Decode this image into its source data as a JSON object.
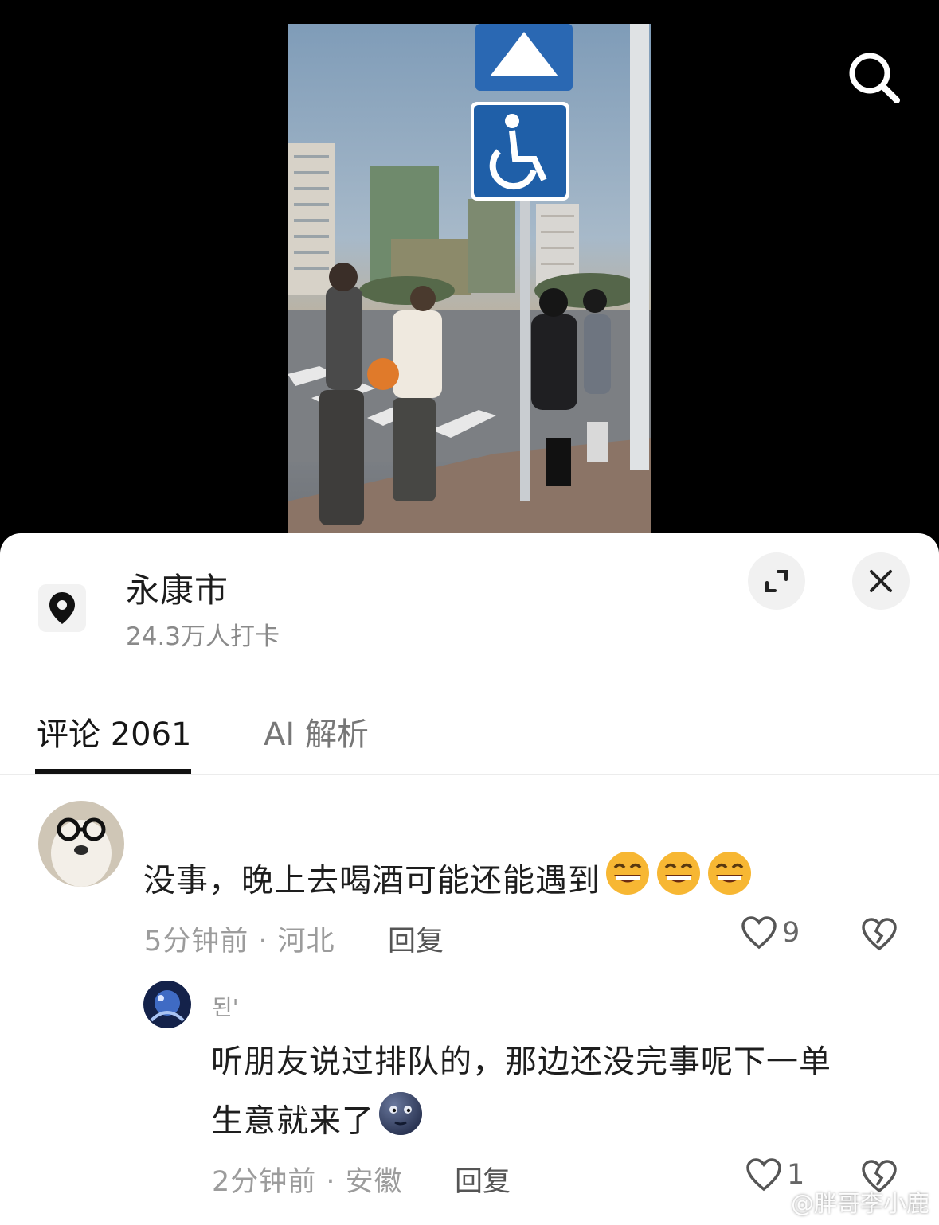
{
  "location": {
    "name": "永康市",
    "checkins": "24.3万人打卡"
  },
  "tabs": [
    {
      "label": "评论 2061",
      "active": true
    },
    {
      "label": "AI 解析",
      "active": false
    }
  ],
  "comments": [
    {
      "text": "没事，晚上去喝酒可能还能遇到",
      "emoji": [
        "grinning-face",
        "grinning-face",
        "grinning-face"
      ],
      "meta": "5分钟前 · 河北",
      "reply_label": "回复",
      "likes": "9",
      "replies": [
        {
          "author": "된'",
          "text_line1": "听朋友说过排队的，那边还没完事呢下一单",
          "text_line2": "生意就来了",
          "emoji": [
            "new-moon-face"
          ],
          "meta": "2分钟前 · 安徽",
          "reply_label": "回复",
          "likes": "1"
        }
      ]
    }
  ],
  "watermark": "@胖哥李小鹿",
  "colors": {
    "sheet_bg": "#ffffff",
    "video_bg": "#000000",
    "sign_blue": "#1f5fa8",
    "text_primary": "#1e1e1e",
    "text_secondary": "#9c9c9c"
  }
}
